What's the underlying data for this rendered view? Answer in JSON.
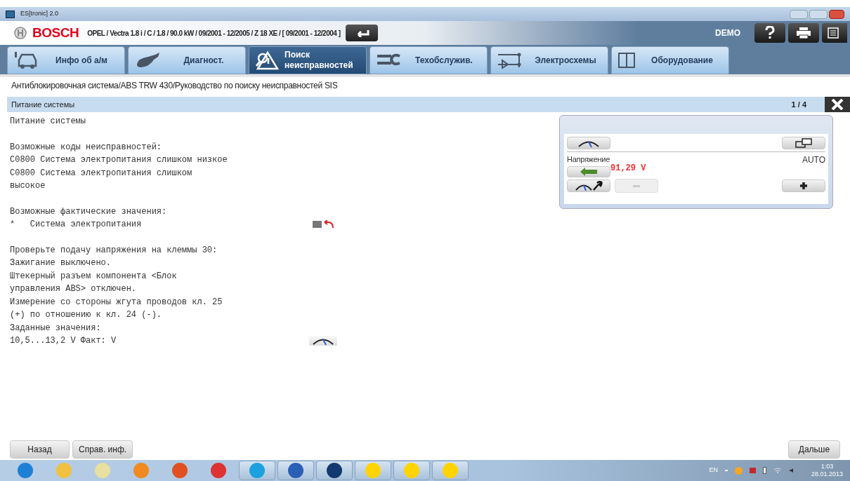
{
  "window": {
    "title": "ES[tronic] 2.0"
  },
  "header": {
    "brand": "BOSCH",
    "vehicle": "OPEL / Vectra 1.8 i / C / 1.8 / 90.0 kW / 09/2001 - 12/2005 / Z 18 XE / [ 09/2001 - 12/2004 ]",
    "mode": "DEMO"
  },
  "tabs": [
    {
      "label": "Инфо об а/м",
      "selected": false
    },
    {
      "label": "Диагност.",
      "selected": false
    },
    {
      "label": "Поиск\nнеисправностей",
      "selected": true
    },
    {
      "label": "Техобслужив.",
      "selected": false
    },
    {
      "label": "Электросхемы",
      "selected": false
    },
    {
      "label": "Оборудование",
      "selected": false
    }
  ],
  "breadcrumb": "Антиблокировочная система/ABS TRW 430/Руководство по поиску неисправностей SIS",
  "section": {
    "title": "Питание системы",
    "page": "1 / 4"
  },
  "paragraphs": [
    [
      {
        "text": "Питание системы"
      }
    ],
    [
      {
        "text": "Возможные коды неисправностей:"
      },
      {
        "text": "C0800 Система электропитания слишком низкое"
      },
      {
        "text": "C0800 Система электропитания слишком"
      },
      {
        "text": "высокое"
      }
    ],
    [
      {
        "text": "Возможные фактические значения:"
      },
      {
        "text": "*   Система электропитания",
        "kind": "values"
      }
    ],
    [
      {
        "text": "Проверьте подачу напряжения на клеммы 30:"
      },
      {
        "text": "Зажигание выключено."
      },
      {
        "text": "Штекерный разъем компонента <Блок"
      },
      {
        "text": "управления ABS> отключен."
      },
      {
        "text": "Измерение со стороны жгута проводов кл. 25"
      },
      {
        "text": "(+) по отношению к кл. 24 (-)."
      },
      {
        "text": "Заданные значения:"
      },
      {
        "text": "10,5...13,2 V Факт: V",
        "kind": "gauge"
      }
    ]
  ],
  "meter": {
    "label": "Напряжение",
    "mode": "AUTO",
    "reading": "91,29 V",
    "minus_disabled": true
  },
  "footer": {
    "left_buttons": [
      "Назад",
      "Справ. инф."
    ],
    "next": "Дальше"
  },
  "taskbar": {
    "apps": [
      {
        "running": false
      },
      {
        "running": false
      },
      {
        "running": false
      },
      {
        "running": false
      },
      {
        "running": false
      },
      {
        "running": false
      },
      {
        "running": true
      },
      {
        "running": true
      },
      {
        "running": true
      },
      {
        "running": true
      },
      {
        "running": true
      },
      {
        "running": true
      }
    ],
    "language": "EN",
    "time": "1:03",
    "date": "28.01.2013"
  }
}
